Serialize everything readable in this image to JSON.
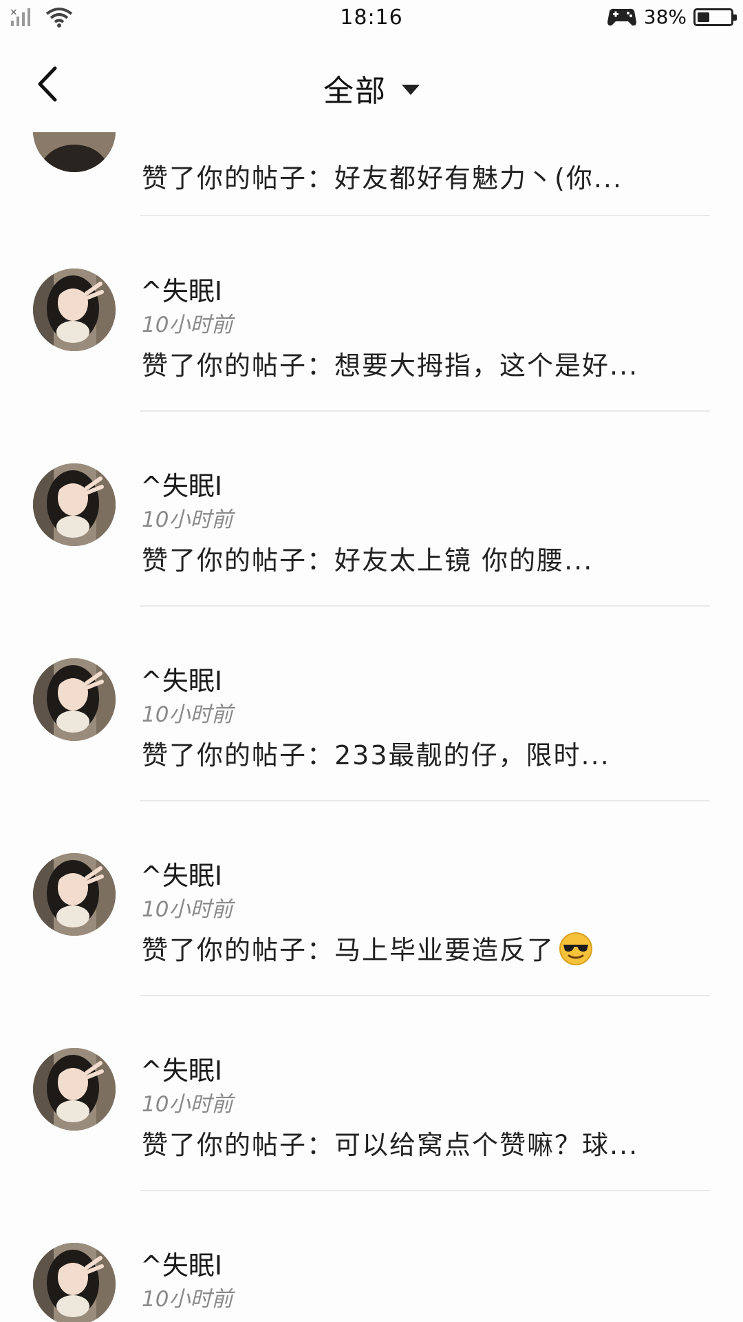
{
  "status_bar": {
    "time": "18:16",
    "battery_percent_text": "38%",
    "battery_level": 0.38
  },
  "nav": {
    "title": "全部"
  },
  "partial_item": {
    "message": "赞了你的帖子：好友都好有魅力丶(你..."
  },
  "items": [
    {
      "username": "^失眠I",
      "time": "10小时前",
      "message": "赞了你的帖子：想要大拇指，这个是好..."
    },
    {
      "username": "^失眠I",
      "time": "10小时前",
      "message": "赞了你的帖子：好友太上镜 你的腰..."
    },
    {
      "username": "^失眠I",
      "time": "10小时前",
      "message": "赞了你的帖子：233最靓的仔，限时..."
    },
    {
      "username": "^失眠I",
      "time": "10小时前",
      "message": "赞了你的帖子：马上毕业要造反了",
      "emoji": "sunglasses-emoji"
    },
    {
      "username": "^失眠I",
      "time": "10小时前",
      "message": "赞了你的帖子：可以给窝点个赞嘛？球..."
    },
    {
      "username": "^失眠I",
      "time": "10小时前",
      "message": ""
    }
  ],
  "icons": {
    "signal": "signal-icon",
    "wifi": "wifi-icon",
    "game": "gamepad-icon",
    "back": "chevron-left-icon",
    "dropdown": "caret-down-icon"
  }
}
